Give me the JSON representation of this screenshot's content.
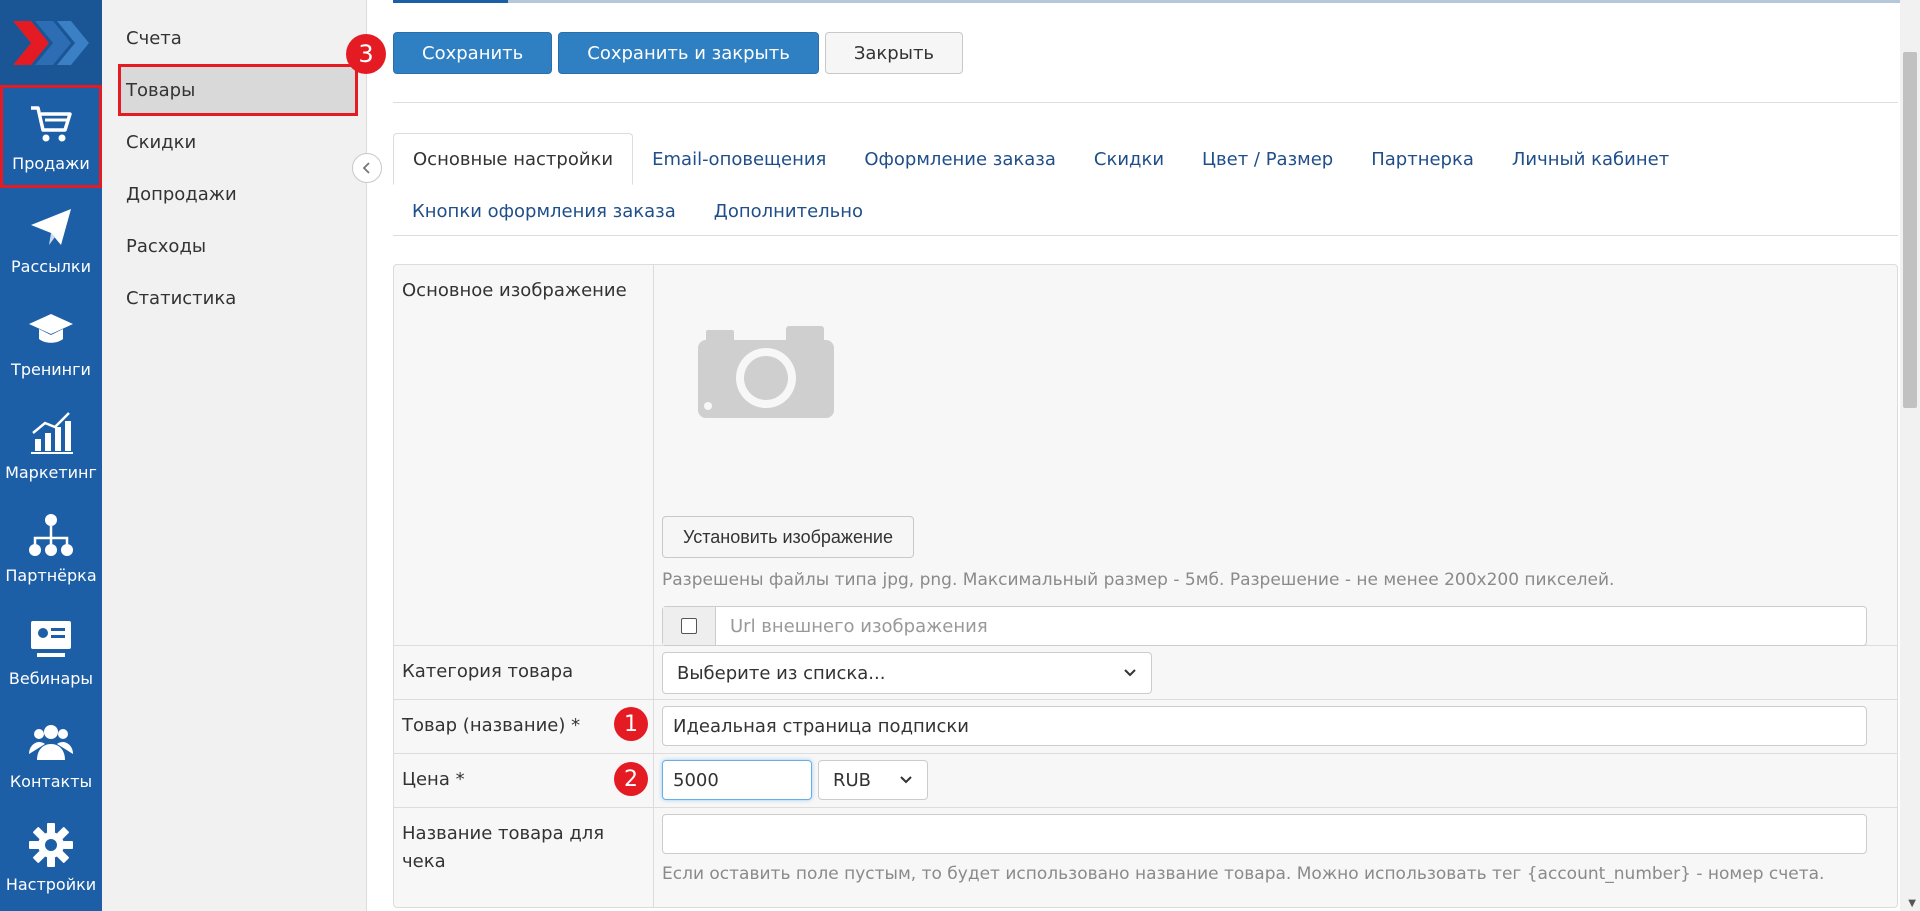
{
  "rail": {
    "items": [
      {
        "label": "Продажи",
        "icon": "cart-icon"
      },
      {
        "label": "Рассылки",
        "icon": "paper-plane-icon"
      },
      {
        "label": "Тренинги",
        "icon": "graduation-cap-icon"
      },
      {
        "label": "Маркетинг",
        "icon": "chart-icon"
      },
      {
        "label": "Партнёрка",
        "icon": "network-icon"
      },
      {
        "label": "Вебинары",
        "icon": "presentation-icon"
      },
      {
        "label": "Контакты",
        "icon": "users-icon"
      },
      {
        "label": "Настройки",
        "icon": "gear-icon"
      }
    ]
  },
  "submenu": {
    "items": [
      "Счета",
      "Товары",
      "Скидки",
      "Допродажи",
      "Расходы",
      "Статистика"
    ]
  },
  "toolbar": {
    "save": "Сохранить",
    "save_close": "Сохранить и закрыть",
    "close": "Закрыть"
  },
  "badges": {
    "one": "1",
    "two": "2",
    "three": "3"
  },
  "tabs": {
    "row1": [
      "Основные настройки",
      "Email-оповещения",
      "Оформление заказа",
      "Скидки",
      "Цвет / Размер",
      "Партнерка",
      "Личный кабинет"
    ],
    "row2": [
      "Кнопки оформления заказа",
      "Дополнительно"
    ]
  },
  "form": {
    "image_label": "Основное изображение",
    "set_image_button": "Установить изображение",
    "image_help": "Разрешены файлы типа jpg, png. Максимальный размер - 5мб. Разрешение - не менее 200x200 пикселей.",
    "url_placeholder": "Url внешнего изображения",
    "category_label": "Категория товара",
    "category_value": "Выберите из списка...",
    "name_label": "Товар (название) *",
    "name_value": "Идеальная страница подписки",
    "price_label": "Цена *",
    "price_value": "5000",
    "currency_value": "RUB",
    "receipt_label": "Название товара для чека",
    "receipt_help": "Если оставить поле пустым, то будет использовано название товара. Можно использовать тег {account_number} - номер счета."
  },
  "colors": {
    "rail": "#1d5fa6",
    "primary_button": "#2f7fc3",
    "highlight": "#e51b24"
  }
}
